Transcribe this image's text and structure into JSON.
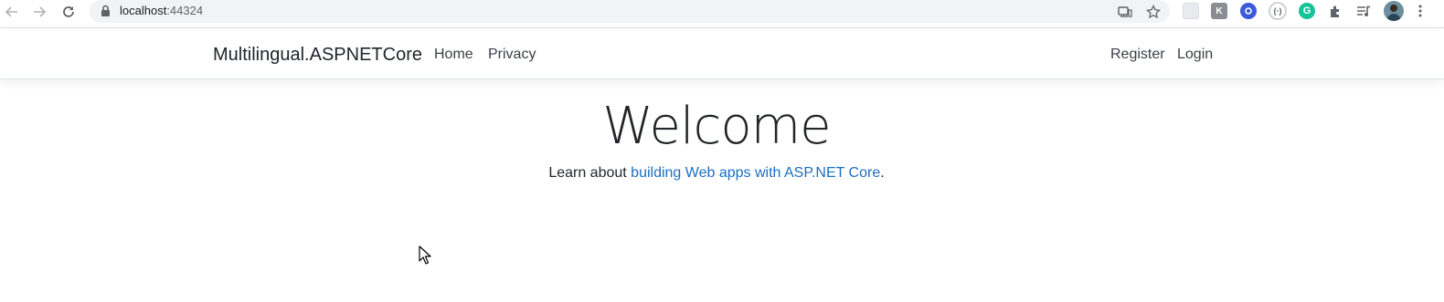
{
  "browser": {
    "url_host": "localhost",
    "url_port": ":44324",
    "icons": [
      "back-icon",
      "forward-icon",
      "reload-icon",
      "lock-icon",
      "cast-icon",
      "star-icon",
      "extensions-icon",
      "media-icon",
      "profile-avatar",
      "menu-icon"
    ]
  },
  "navbar": {
    "brand": "Multilingual.ASPNETCore",
    "links": {
      "home": "Home",
      "privacy": "Privacy",
      "register": "Register",
      "login": "Login"
    }
  },
  "main": {
    "heading": "Welcome",
    "lead_prefix": "Learn about ",
    "lead_link": "building Web apps with ASP.NET Core",
    "lead_suffix": "."
  },
  "colors": {
    "link": "#1b6ec2",
    "text": "#212529",
    "omnibox": "#f1f3f4"
  }
}
